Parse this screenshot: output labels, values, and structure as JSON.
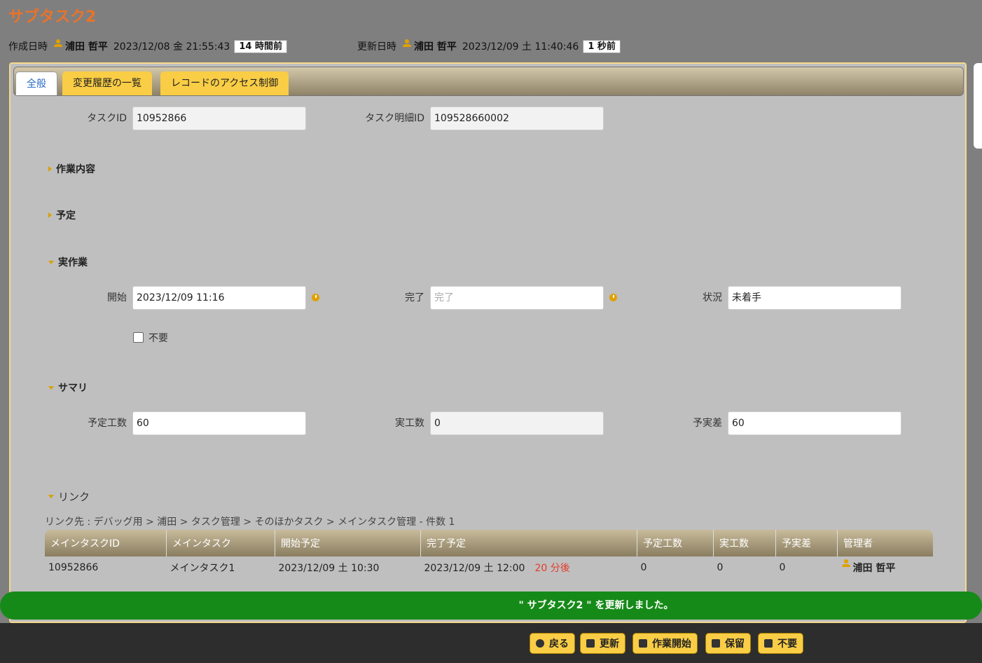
{
  "page": {
    "title": "サブタスク2"
  },
  "meta": {
    "created_label": "作成日時",
    "created_user": "浦田 哲平",
    "created_at": "2023/12/08 金 21:55:43",
    "created_ago": "14 時間前",
    "updated_label": "更新日時",
    "updated_user": "浦田 哲平",
    "updated_at": "2023/12/09 土 11:40:46",
    "updated_ago": "1 秒前"
  },
  "tabs": [
    "全般",
    "変更履歴の一覧",
    "レコードのアクセス制御"
  ],
  "fields": {
    "task_id": {
      "label": "タスクID",
      "value": "10952866"
    },
    "task_detail_id": {
      "label": "タスク明細ID",
      "value": "109528660002"
    }
  },
  "sections": {
    "work": "作業内容",
    "plan": "予定",
    "actual": "実作業",
    "summary": "サマリ",
    "link": "リンク"
  },
  "actual": {
    "start_label": "開始",
    "start_value": "2023/12/09 11:16",
    "end_label": "完了",
    "end_placeholder": "完了",
    "status_label": "状況",
    "status_value": "未着手",
    "unneeded_label": "不要"
  },
  "summary": {
    "planned_label": "予定工数",
    "planned_value": "60",
    "actual_label": "実工数",
    "actual_value": "0",
    "diff_label": "予実差",
    "diff_value": "60"
  },
  "link": {
    "breadcrumb": "リンク先 : デバッグ用 > 浦田 > タスク管理 > そのほかタスク > メインタスク管理 - 件数 1",
    "columns": [
      "メインタスクID",
      "メインタスク",
      "開始予定",
      "完了予定",
      "予定工数",
      "実工数",
      "予実差",
      "管理者"
    ],
    "rows": [
      {
        "id": "10952866",
        "name": "メインタスク1",
        "start": "2023/12/09 土 10:30",
        "end": "2023/12/09 土 12:00",
        "end_rel": "20 分後",
        "planned": "0",
        "actual": "0",
        "diff": "0",
        "manager": "浦田 哲平"
      }
    ]
  },
  "toast": "\" サブタスク2 \" を更新しました。",
  "buttons": {
    "back": "戻る",
    "update": "更新",
    "start": "作業開始",
    "hold": "保留",
    "unneeded": "不要"
  }
}
